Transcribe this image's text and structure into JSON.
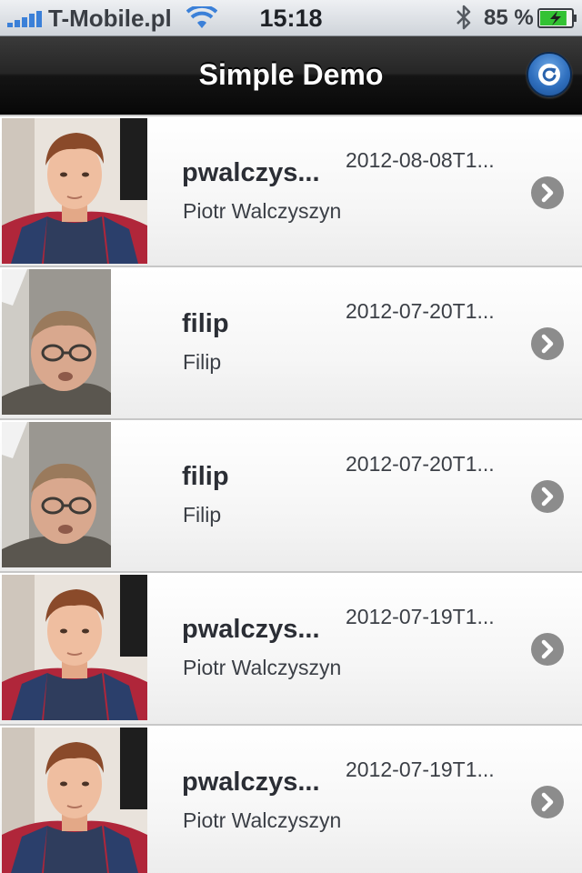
{
  "status_bar": {
    "carrier": "T-Mobile.pl",
    "time": "15:18",
    "battery": "85 %",
    "battery_level": 0.85,
    "icons": [
      "signal-bars-icon",
      "wifi-icon",
      "bluetooth-icon",
      "battery-charging-icon"
    ]
  },
  "nav": {
    "title": "Simple Demo",
    "refresh_icon": "refresh-icon",
    "bar_color": "#1b1b1b",
    "button_color": "#2f6fbe"
  },
  "rows": [
    {
      "username": "pwalczys...",
      "name": "Piotr Walczyszyn",
      "date": "2012-08-08T1...",
      "avatar": "man"
    },
    {
      "username": "filip",
      "name": "Filip",
      "date": "2012-07-20T1...",
      "avatar": "glasses"
    },
    {
      "username": "filip",
      "name": "Filip",
      "date": "2012-07-20T1...",
      "avatar": "glasses"
    },
    {
      "username": "pwalczys...",
      "name": "Piotr Walczyszyn",
      "date": "2012-07-19T1...",
      "avatar": "man"
    },
    {
      "username": "pwalczys...",
      "name": "Piotr Walczyszyn",
      "date": "2012-07-19T1...",
      "avatar": "man"
    }
  ]
}
